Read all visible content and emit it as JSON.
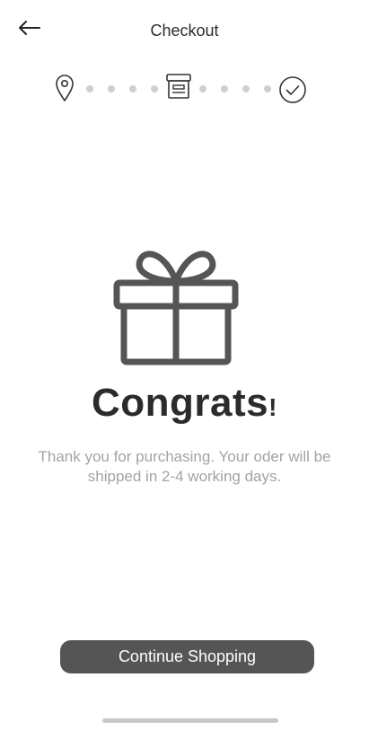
{
  "header": {
    "title": "Checkout",
    "back_icon": "arrow-left-icon"
  },
  "stepper": {
    "steps": [
      "location-pin-icon",
      "package-box-icon",
      "check-circle-icon"
    ],
    "completed": 3,
    "total": 3
  },
  "hero": {
    "icon": "gift-icon",
    "heading": "Congrats",
    "heading_suffix": "!",
    "message": "Thank you for purchasing. Your oder will be shipped in 2-4 working days."
  },
  "actions": {
    "continue_label": "Continue Shopping"
  },
  "colors": {
    "primary_button": "#555555",
    "icon_stroke": "#555555",
    "muted_text": "#a3a3a3",
    "dot": "#cfcfcf"
  }
}
